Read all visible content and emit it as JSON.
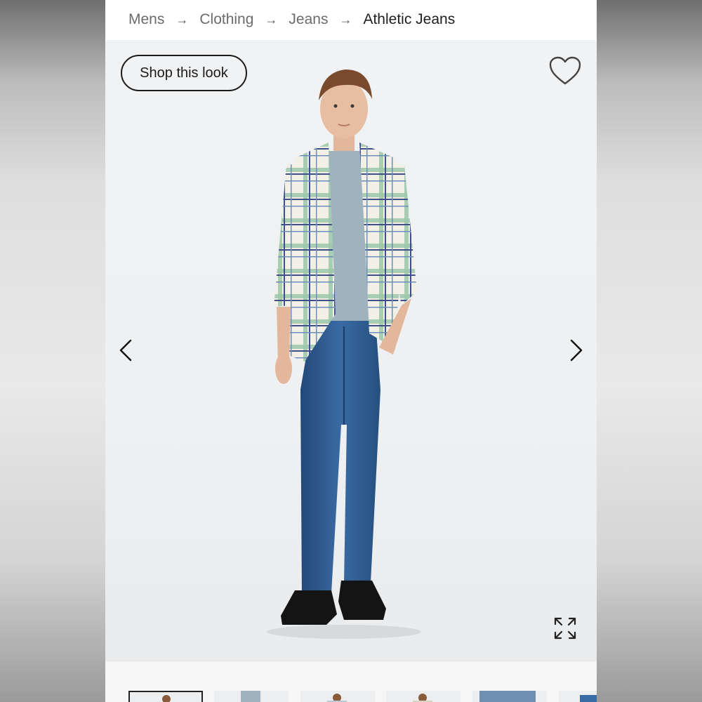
{
  "breadcrumb": {
    "items": [
      "Mens",
      "Clothing",
      "Jeans"
    ],
    "separator": "→",
    "current": "Athletic Jeans"
  },
  "gallery": {
    "shop_look_label": "Shop this look",
    "icons": {
      "favorite": "heart-icon",
      "previous": "chevron-left-icon",
      "next": "chevron-right-icon",
      "expand": "expand-icon"
    }
  },
  "thumbnails": {
    "count_visible": 6,
    "active_index": 0
  },
  "colors": {
    "text_primary": "#1f1f1f",
    "text_muted": "#6b6b6b",
    "denim": "#2f5f96",
    "background": "#eff1f2"
  }
}
